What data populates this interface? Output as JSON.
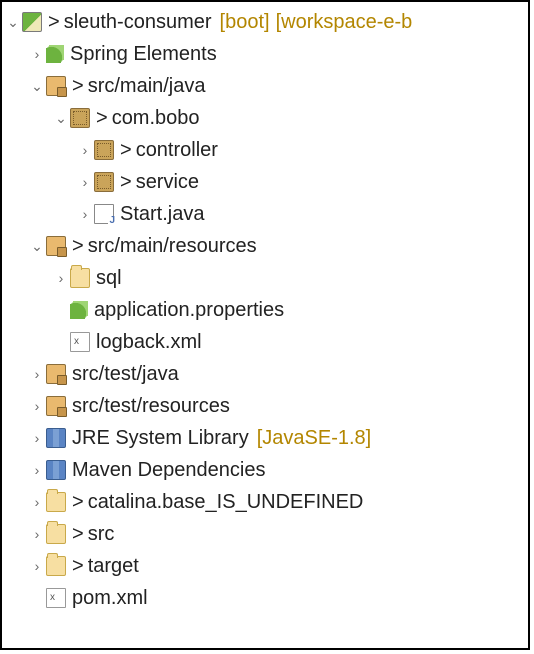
{
  "project": {
    "name": "sleuth-consumer",
    "boot_decoration": "[boot]",
    "working_set_decoration": "[workspace-e-b",
    "vcs_marker": ">"
  },
  "nodes": {
    "spring_elements": {
      "label": "Spring Elements"
    },
    "src_main_java": {
      "label": "src/main/java",
      "vcs": ">"
    },
    "pkg_com_bobo": {
      "label": "com.bobo",
      "vcs": ">"
    },
    "pkg_controller": {
      "label": "controller",
      "vcs": ">"
    },
    "pkg_service": {
      "label": "service",
      "vcs": ">"
    },
    "file_start_java": {
      "label": "Start.java"
    },
    "src_main_resources": {
      "label": "src/main/resources",
      "vcs": ">"
    },
    "folder_sql": {
      "label": "sql"
    },
    "file_app_props": {
      "label": "application.properties"
    },
    "file_logback": {
      "label": "logback.xml"
    },
    "src_test_java": {
      "label": "src/test/java"
    },
    "src_test_resources": {
      "label": "src/test/resources"
    },
    "jre_lib": {
      "label": "JRE System Library",
      "decoration": "[JavaSE-1.8]"
    },
    "maven_deps": {
      "label": "Maven Dependencies"
    },
    "catalina": {
      "label": "catalina.base_IS_UNDEFINED",
      "vcs": ">"
    },
    "src_folder": {
      "label": "src",
      "vcs": ">"
    },
    "target_folder": {
      "label": "target",
      "vcs": ">"
    },
    "pom": {
      "label": "pom.xml"
    }
  }
}
